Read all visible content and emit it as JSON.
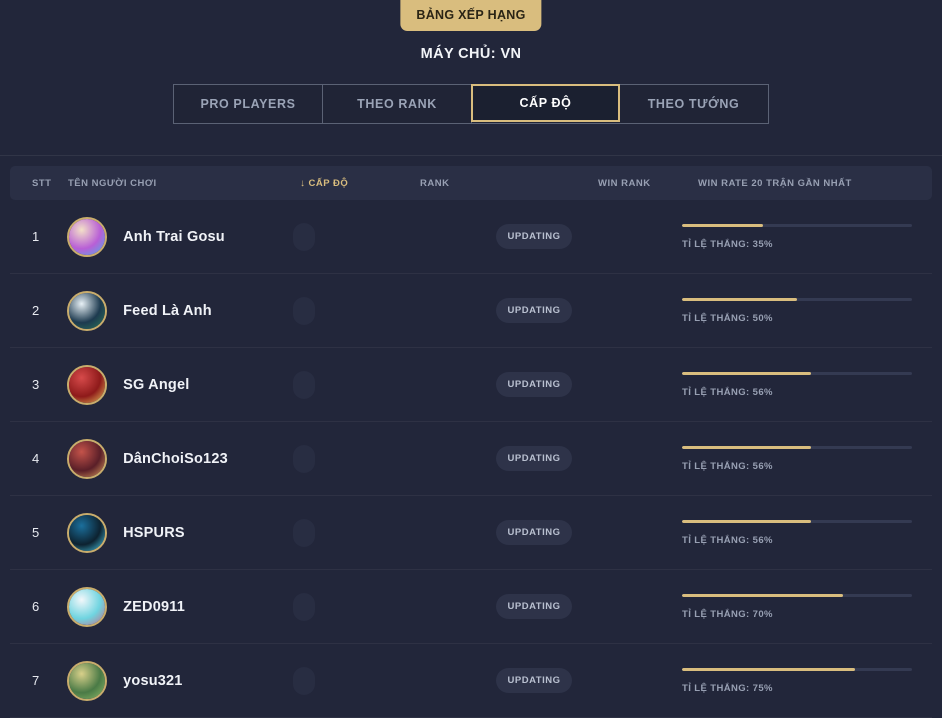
{
  "hero": {
    "badge_label": "BẢNG XẾP HẠNG",
    "server_label": "MÁY CHỦ: VN",
    "accent_gold": "#d9bd7e",
    "background_dark": "#22263a"
  },
  "tabs": [
    {
      "label": "PRO PLAYERS",
      "active": false
    },
    {
      "label": "THEO RANK",
      "active": false
    },
    {
      "label": "CẤP ĐỘ",
      "active": true
    },
    {
      "label": "THEO TƯỚNG",
      "active": false
    }
  ],
  "table": {
    "columns": {
      "stt": "STT",
      "name": "TÊN NGƯỜI CHƠI",
      "level": "CẤP ĐỘ",
      "rank": "RANK",
      "win_rank": "WIN RANK",
      "win_rate": "WIN RATE 20 TRẬN GẦN NHẤT"
    },
    "sort_column": "level",
    "sort_icon": "arrow-down-icon",
    "sort_arrow_glyph": "↓",
    "rows": [
      {
        "stt": "1",
        "name": "Anh Trai Gosu",
        "level": "",
        "rank_badge": "UPDATING",
        "win_rank": "",
        "win_rate_label": "TỈ LỆ THẮNG: 35%",
        "win_rate_percent": 35,
        "avatar_colors": [
          "#b85fd6",
          "#f3e0c8",
          "#4bb0e8"
        ]
      },
      {
        "stt": "2",
        "name": "Feed Là Anh",
        "level": "",
        "rank_badge": "UPDATING",
        "win_rank": "",
        "win_rate_label": "TỈ LỆ THẮNG: 50%",
        "win_rate_percent": 50,
        "avatar_colors": [
          "#1d3a4f",
          "#e8f1f6",
          "#2d7a5a"
        ]
      },
      {
        "stt": "3",
        "name": "SG Angel",
        "level": "",
        "rank_badge": "UPDATING",
        "win_rank": "",
        "win_rate_label": "TỈ LỆ THẮNG: 56%",
        "win_rate_percent": 56,
        "avatar_colors": [
          "#8e1a1a",
          "#d64a4a",
          "#e8c45c"
        ]
      },
      {
        "stt": "4",
        "name": "DânChoiSo123",
        "level": "",
        "rank_badge": "UPDATING",
        "win_rank": "",
        "win_rate_label": "TỈ LỆ THẮNG: 56%",
        "win_rate_percent": 56,
        "avatar_colors": [
          "#5a1f28",
          "#c4534a",
          "#e0a060"
        ]
      },
      {
        "stt": "5",
        "name": "HSPURS",
        "level": "",
        "rank_badge": "UPDATING",
        "win_rank": "",
        "win_rate_label": "TỈ LỆ THẮNG: 56%",
        "win_rate_percent": 56,
        "avatar_colors": [
          "#0d2230",
          "#1b6f9c",
          "#49d2f0"
        ]
      },
      {
        "stt": "6",
        "name": "ZED0911",
        "level": "",
        "rank_badge": "UPDATING",
        "win_rank": "",
        "win_rate_label": "TỈ LỆ THẮNG: 70%",
        "win_rate_percent": 70,
        "avatar_colors": [
          "#6fd4e0",
          "#f2f7fa",
          "#c86a86"
        ]
      },
      {
        "stt": "7",
        "name": "yosu321",
        "level": "",
        "rank_badge": "UPDATING",
        "win_rank": "",
        "win_rate_label": "TỈ LỆ THẮNG: 75%",
        "win_rate_percent": 75,
        "avatar_colors": [
          "#4a7a46",
          "#d8d08a",
          "#8fbc6a"
        ]
      }
    ]
  }
}
